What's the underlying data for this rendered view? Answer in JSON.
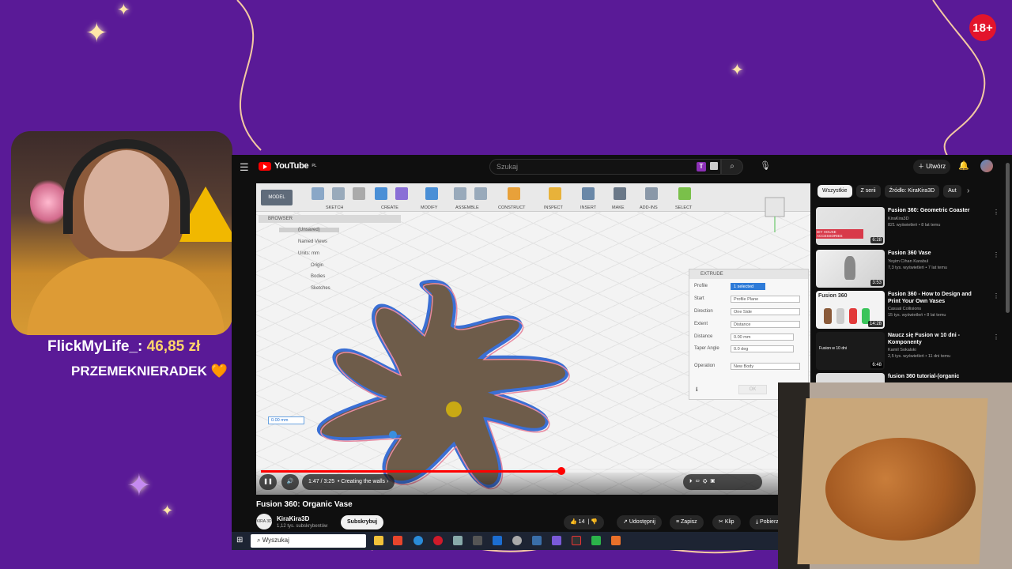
{
  "badge": "18+",
  "stream": {
    "donation_name": "FlickMyLife_:",
    "donation_amount": "46,85 zł",
    "supporter": "PRZEMEKNIERADEK",
    "heart": "🧡"
  },
  "youtube": {
    "logo": "YouTube",
    "logo_suffix": "PL",
    "search_placeholder": "Szukaj",
    "ext_letter": "T",
    "create_label": "Utwórz",
    "video": {
      "ribbon": {
        "model": "MODEL",
        "groups": [
          "SKETCH",
          "CREATE",
          "MODIFY",
          "ASSEMBLE",
          "CONSTRUCT",
          "INSPECT",
          "INSERT",
          "MAKE",
          "ADD-INS",
          "SELECT"
        ]
      },
      "browser": {
        "title": "BROWSER",
        "root": "(Unsaved)",
        "items": [
          "Named Views",
          "Units: mm",
          "Origin",
          "Bodies",
          "Sketches"
        ]
      },
      "extrude": {
        "title": "EXTRUDE",
        "rows": [
          {
            "label": "Profile",
            "value": "1 selected"
          },
          {
            "label": "Start",
            "value": "Profile Plane"
          },
          {
            "label": "Direction",
            "value": "One Side"
          },
          {
            "label": "Extent",
            "value": "Distance"
          },
          {
            "label": "Distance",
            "value": "0.00 mm"
          },
          {
            "label": "Taper Angle",
            "value": "0.0 deg"
          },
          {
            "label": "Operation",
            "value": "New Body"
          }
        ],
        "ok": "OK"
      },
      "distance_field": "0.00 mm",
      "time": "1:47 / 3:25",
      "chapter": "Creating the walls",
      "progress": 0.55
    },
    "title": "Fusion 360: Organic Vase",
    "channel": {
      "avatar_text": "KIRA 3D",
      "name": "KiraKira3D",
      "subs": "1,12 tys. subskrybentów",
      "subscribe": "Subskrybuj"
    },
    "actions": {
      "likes": "14",
      "share": "Udostępnij",
      "save": "Zapisz",
      "clip": "Klip",
      "download": "Pobierz"
    },
    "chips": [
      "Wszystkie",
      "Z serii",
      "Źródło: KiraKira3D",
      "Aut"
    ],
    "recommended": [
      {
        "title": "Fusion 360: Geometric Coaster",
        "channel": "KiraKira3D",
        "meta": "821 wyświetleń • 8 lat temu",
        "duration": "6:28",
        "thumb_text": "DIY HOUSE ACCESSORIES"
      },
      {
        "title": "Fusion 360 Vase",
        "channel": "Yeşim Cihan Karabul",
        "meta": "7,3 tys. wyświetleń • 7 lat temu",
        "duration": "3:53",
        "thumb_text": ""
      },
      {
        "title": "Fusion 360 - How to Design and Print Your Own Vases",
        "channel": "Casual Collisions",
        "meta": "15 tys. wyświetleń • 8 lat temu",
        "duration": "14:28",
        "thumb_text": "Fusion 360"
      },
      {
        "title": "Naucz się Fusion w 10 dni - Komponenty",
        "channel": "Kamil Sokalski",
        "meta": "2,5 tys. wyświetleń • 11 dni temu",
        "duration": "6:48",
        "thumb_text": "Fusion w 10 dni"
      },
      {
        "title": "fusion 360 tutorial-(organic",
        "channel": "",
        "meta": "",
        "duration": "",
        "thumb_text": ""
      }
    ]
  },
  "taskbar": {
    "search": "Wyszukaj"
  },
  "colors": {
    "background": "#5a1a97",
    "youtube_red": "#ff0000",
    "accent_gold": "#ffd56a"
  }
}
